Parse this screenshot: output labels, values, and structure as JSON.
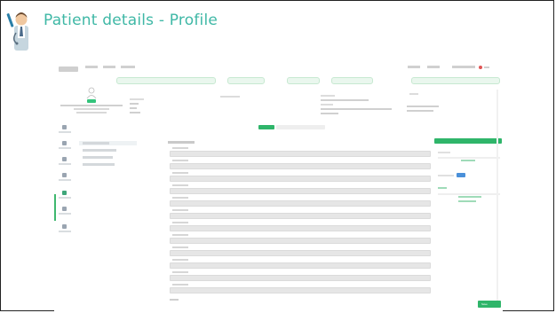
{
  "slide": {
    "title": "Patient details - Profile"
  },
  "colors": {
    "accent_teal": "#3fb8a6",
    "brand_green": "#2fb56a",
    "alert_red": "#e05555",
    "info_blue": "#4a90d9"
  },
  "mockup": {
    "save_label": "Save",
    "form_fields_count": 12
  }
}
